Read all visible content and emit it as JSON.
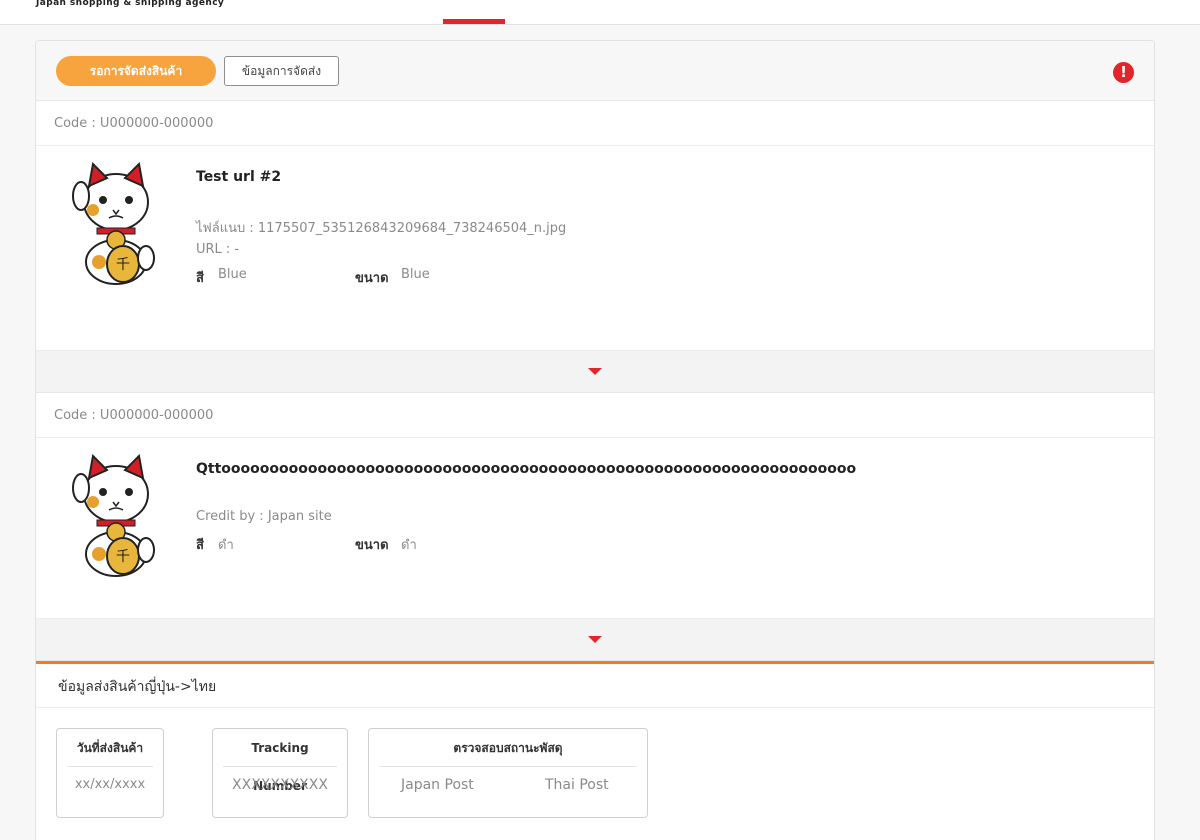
{
  "header": {
    "tagline": "Japan shopping & shipping agency"
  },
  "order": {
    "status_button": "รอการจัดส่งสินค้า",
    "info_button": "ข้อมูลการจัดส่ง",
    "alert_symbol": "!"
  },
  "items": [
    {
      "code": "Code : U000000-000000",
      "title": "Test url #2",
      "attachment": "ไฟล์แนบ : 1175507_535126843209684_738246504_n.jpg",
      "url": "URL : -",
      "color_label": "สี",
      "color_value": "Blue",
      "size_label": "ขนาด",
      "size_value": "Blue"
    },
    {
      "code": "Code : U000000-000000",
      "title": "Qttoooooooooooooooooooooooooooooooooooooooooooooooooooooooooooooooooo",
      "credit": "Credit by : Japan site",
      "color_label": "สี",
      "color_value": "ดำ",
      "size_label": "ขนาด",
      "size_value": "ดำ"
    }
  ],
  "shipping": {
    "section_title": "ข้อมูลส่งสินค้าญี่ปุ่น->ไทย",
    "ship_date_label": "วันที่ส่งสินค้า",
    "ship_date_value": "xx/xx/xxxx",
    "tracking_label": "Tracking Number",
    "tracking_value": "XXXXXXXXXX",
    "status_check_label": "ตรวจสอบสถานะพัสดุ",
    "japan_post": "Japan Post",
    "thai_post": "Thai Post"
  },
  "colors": {
    "accent_orange": "#f7a33e",
    "section_orange": "#f47b20",
    "brand_red": "#e3242b"
  },
  "icons": {
    "product_image": "maneki-neko-cat",
    "alert": "exclamation-circle-icon",
    "expander": "caret-down-icon"
  }
}
